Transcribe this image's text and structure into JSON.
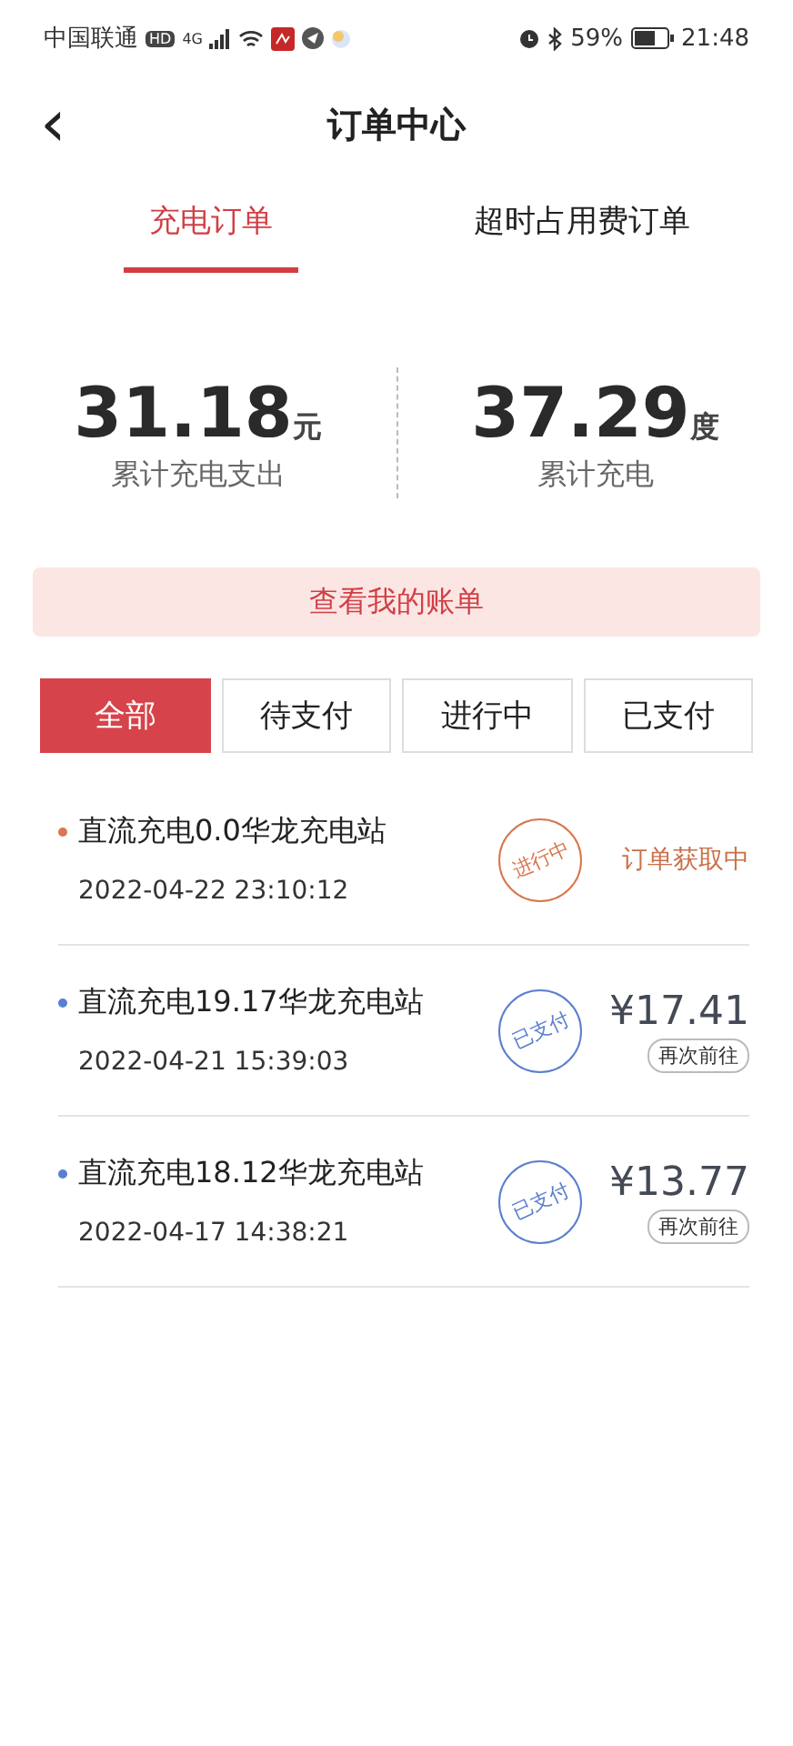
{
  "status_bar": {
    "carrier": "中国联通",
    "hd": "HD",
    "network": "4G",
    "battery": "59%",
    "time": "21:48"
  },
  "header": {
    "back": "‹",
    "title": "订单中心"
  },
  "tabs": [
    {
      "label": "充电订单",
      "selected": true
    },
    {
      "label": "超时占用费订单",
      "selected": false
    }
  ],
  "summary": [
    {
      "value": "31.18",
      "unit": "元",
      "label": "累计充电支出"
    },
    {
      "value": "37.29",
      "unit": "度",
      "label": "累计充电"
    }
  ],
  "bill_button": "查看我的账单",
  "filters": [
    {
      "label": "全部",
      "selected": true
    },
    {
      "label": "待支付",
      "selected": false
    },
    {
      "label": "进行中",
      "selected": false
    },
    {
      "label": "已支付",
      "selected": false
    }
  ],
  "orders": [
    {
      "kind": "in_progress",
      "title": "直流充电0.0华龙充电站",
      "time": "2022-04-22 23:10:12",
      "stamp": "进行中",
      "color": "#d9774f",
      "status": "订单获取中"
    },
    {
      "kind": "paid",
      "title": "直流充电19.17华龙充电站",
      "time": "2022-04-21 15:39:03",
      "stamp": "已支付",
      "color": "#5b7fcf",
      "amount": "¥17.41",
      "action": "再次前往"
    },
    {
      "kind": "paid",
      "title": "直流充电18.12华龙充电站",
      "time": "2022-04-17 14:38:21",
      "stamp": "已支付",
      "color": "#5b7fcf",
      "amount": "¥13.77",
      "action": "再次前往"
    }
  ]
}
